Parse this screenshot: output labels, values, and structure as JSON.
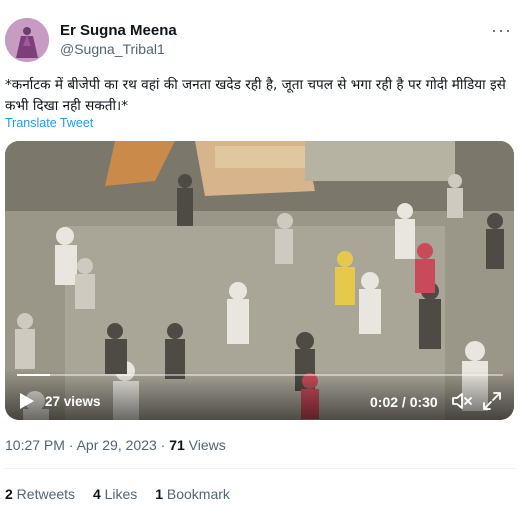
{
  "author": {
    "name": "Er Sugna Meena",
    "handle": "@Sugna_Tribal1"
  },
  "more_label": "···",
  "tweet": {
    "text": "*कर्नाटक में बीजेपी का रथ वहां की जनता खदेड रही है, जूता चपल से भगा रही है पर गोदी मीडिया इसे कभी दिखा नही सकती।*",
    "translate_label": "Translate Tweet"
  },
  "video": {
    "views": "27 views",
    "time": "0:02 / 0:30",
    "progress": 0.067
  },
  "meta": {
    "time": "10:27 PM · Apr 29, 2023",
    "separator": " · ",
    "views_count": "71",
    "views_label": " Views"
  },
  "stats": {
    "retweets_count": "2",
    "retweets_label": " Retweets",
    "likes_count": "4",
    "likes_label": " Likes",
    "bookmarks_count": "1",
    "bookmarks_label": " Bookmark"
  },
  "colors": {
    "link": "#1d9bf0",
    "secondary": "#536471",
    "primary": "#0f1419"
  }
}
